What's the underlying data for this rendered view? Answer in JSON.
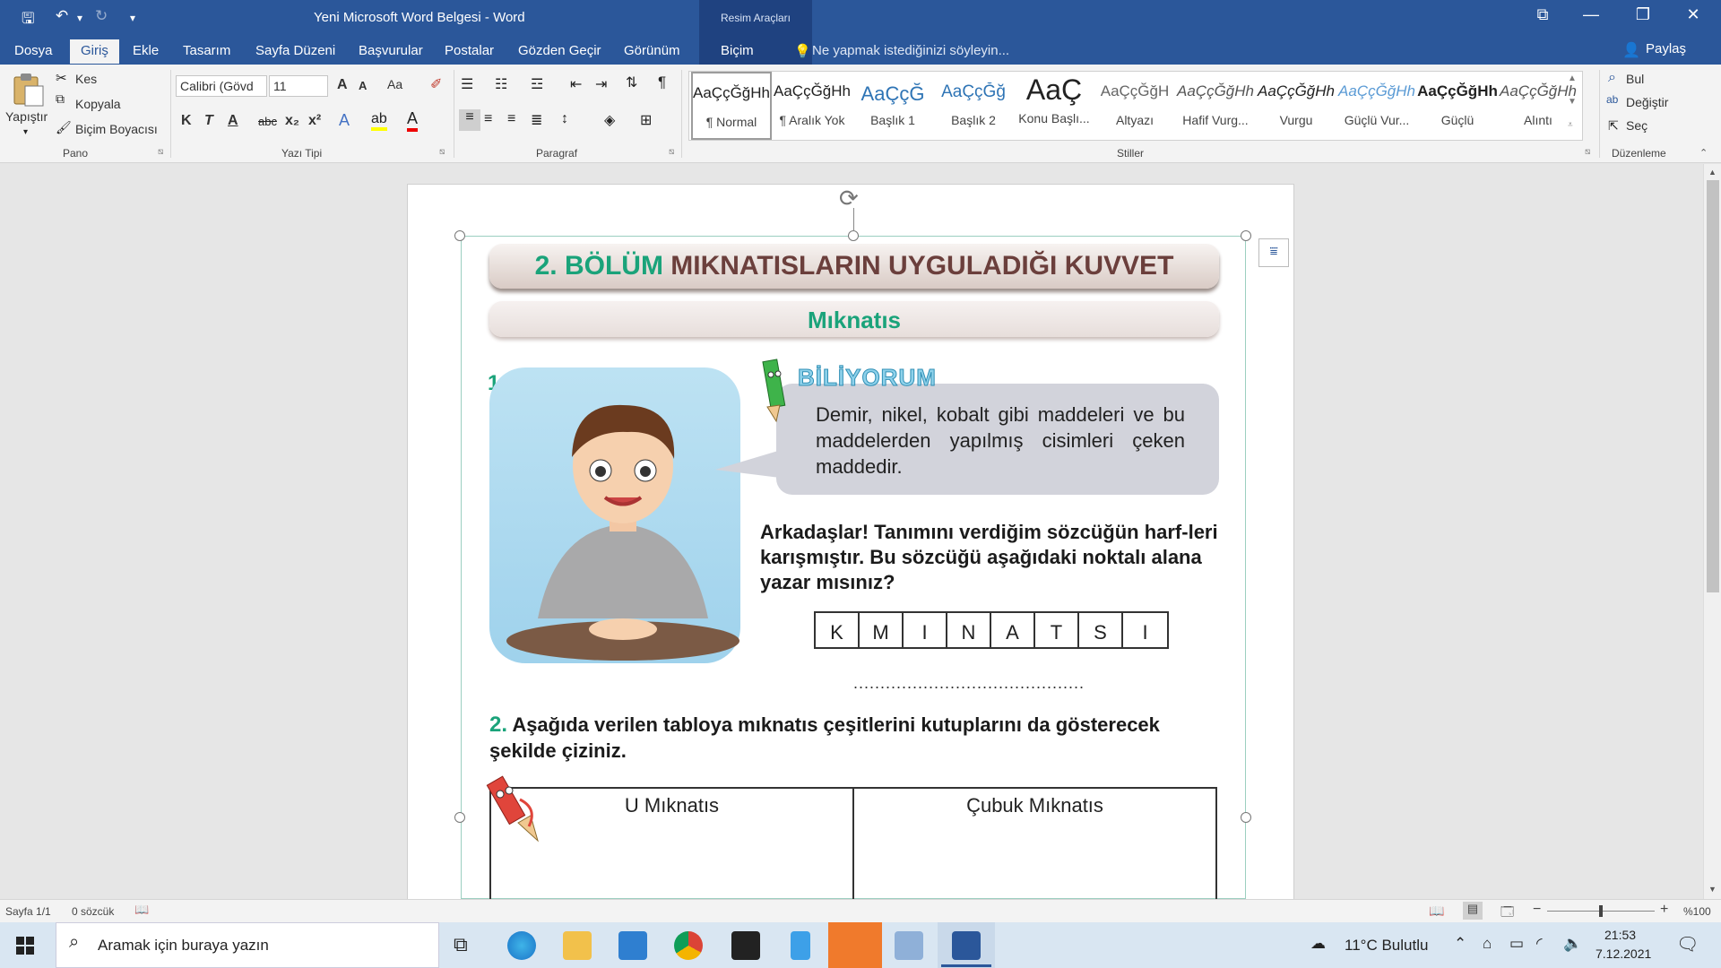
{
  "titlebar": {
    "document_title": "Yeni Microsoft Word Belgesi - Word",
    "context_group": "Resim Araçları",
    "qa_save": "🖫",
    "qa_undo": "↶",
    "qa_redo": "↻",
    "qa_customize": "▾",
    "restore_ribbon": "⧉",
    "minimize": "—",
    "maximize": "❐",
    "close": "✕"
  },
  "tabs": {
    "items": [
      "Dosya",
      "Giriş",
      "Ekle",
      "Tasarım",
      "Sayfa Düzeni",
      "Başvurular",
      "Postalar",
      "Gözden Geçir",
      "Görünüm",
      "Biçim"
    ],
    "active": "Giriş",
    "tell_me": "Ne yapmak istediğinizi söyleyin...",
    "share": "Paylaş"
  },
  "ribbon": {
    "clipboard": {
      "paste": "Yapıştır",
      "cut": "Kes",
      "copy": "Kopyala",
      "format_painter": "Biçim Boyacısı",
      "group_label": "Pano"
    },
    "font": {
      "font_name": "Calibri (Gövd",
      "font_size": "11",
      "bold": "K",
      "italic": "T",
      "underline": "A",
      "strike": "abc",
      "subscript": "x₂",
      "superscript": "x²",
      "grow": "A",
      "shrink": "A",
      "case": "Aa",
      "group_label": "Yazı Tipi"
    },
    "paragraph": {
      "group_label": "Paragraf",
      "pilcrow": "¶"
    },
    "styles": {
      "group_label": "Stiller",
      "items": [
        {
          "sample": "AaÇçĞğHh",
          "name": "¶ Normal"
        },
        {
          "sample": "AaÇçĞğHh",
          "name": "¶ Aralık Yok"
        },
        {
          "sample": "AaÇçĞ",
          "name": "Başlık 1"
        },
        {
          "sample": "AaÇçĞğ",
          "name": "Başlık 2"
        },
        {
          "sample": "AaÇ",
          "name": "Konu Başlı..."
        },
        {
          "sample": "AaÇçĞğH",
          "name": "Altyazı"
        },
        {
          "sample": "AaÇçĞğHh",
          "name": "Hafif Vurg..."
        },
        {
          "sample": "AaÇçĞğHh",
          "name": "Vurgu"
        },
        {
          "sample": "AaÇçĞğHh",
          "name": "Güçlü Vur..."
        },
        {
          "sample": "AaÇçĞğHh",
          "name": "Güçlü"
        },
        {
          "sample": "AaÇçĞğHh",
          "name": "Alıntı"
        }
      ]
    },
    "editing": {
      "find": "Bul",
      "replace": "Değiştir",
      "select": "Seç",
      "group_label": "Düzenleme"
    }
  },
  "worksheet": {
    "heading_num": "2. BÖLÜM",
    "heading_rest": "MIKNATISLARIN UYGULADIĞI KUVVET",
    "subheading": "Mıknatıs",
    "q1_num": "1.",
    "biliyorum": "BİLİYORUM",
    "bubble_text": "Demir, nikel, kobalt gibi maddeleri ve bu maddelerden yapılmış cisimleri çeken maddedir.",
    "prompt": "Arkadaşlar! Tanımını verdiğim sözcüğün harf-leri karışmıştır. Bu sözcüğü aşağıdaki noktalı alana yazar mısınız?",
    "letters": [
      "K",
      "M",
      "I",
      "N",
      "A",
      "T",
      "S",
      "I"
    ],
    "dots": "...........................................",
    "q2_num": "2.",
    "q2_text": "Aşağıda verilen tabloya mıknatıs çeşitlerini kutuplarını da gösterecek şekilde çiziniz.",
    "table_headers": [
      "U Mıknatıs",
      "Çubuk Mıknatıs"
    ]
  },
  "statusbar": {
    "page": "Sayfa 1/1",
    "words": "0 sözcük",
    "zoom": "%100",
    "zoom_level_fraction": 0.5
  },
  "taskbar": {
    "search_placeholder": "Aramak için buraya yazın",
    "weather": "11°C  Bulutlu",
    "time": "21:53",
    "date": "7.12.2021"
  },
  "colors": {
    "word_blue": "#2b579a",
    "worksheet_green": "#1aa37a",
    "banner_brown": "#6b3f3c"
  }
}
